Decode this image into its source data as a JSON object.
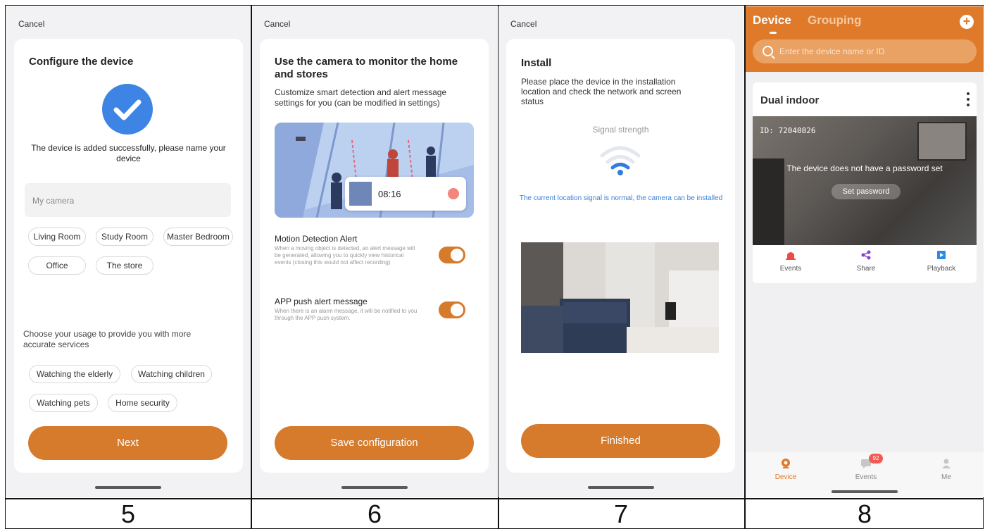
{
  "screen5": {
    "cancel": "Cancel",
    "title": "Configure the device",
    "success_text": "The device is added successfully, please name your device",
    "name_placeholder": "My camera",
    "room_chips": [
      "Living Room",
      "Study Room",
      "Master Bedroom",
      "Office",
      "The store"
    ],
    "usage_prompt": "Choose your usage to provide you with more accurate services",
    "usage_chips": [
      "Watching the elderly",
      "Watching children",
      "Watching pets",
      "Home security"
    ],
    "next_label": "Next"
  },
  "screen6": {
    "cancel": "Cancel",
    "title": "Use the camera to monitor the home and stores",
    "subtitle": "Customize smart detection and alert message settings for you (can be modified in settings)",
    "illustration_time": "08:16",
    "motion_title": "Motion Detection Alert",
    "motion_desc": "When a moving object is detected, an alert message will be generated, allowing you to quickly view historical events (closing this would not affect recording)",
    "push_title": "APP push alert message",
    "push_desc": "When there is an alarm message, it will be notified to you through the APP push system.",
    "save_label": "Save configuration"
  },
  "screen7": {
    "cancel": "Cancel",
    "title": "Install",
    "desc": "Please place the device in the installation location and check the network and screen status",
    "signal_label": "Signal strength",
    "signal_status": "The current location signal is normal, the camera can be installed",
    "finished_label": "Finished"
  },
  "screen8": {
    "tab_device": "Device",
    "tab_grouping": "Grouping",
    "search_placeholder": "Enter the device name or ID",
    "device_name": "Dual indoor",
    "device_id": "ID: 72040826",
    "no_password": "The device does not have a password set",
    "set_password": "Set password",
    "actions": [
      "Events",
      "Share",
      "Playback"
    ],
    "nav": [
      "Device",
      "Events",
      "Me"
    ],
    "events_badge": "92"
  },
  "step_numbers": [
    "5",
    "6",
    "7",
    "8"
  ],
  "colors": {
    "accent": "#d67a2c",
    "blue": "#2f7de0",
    "background": "#f2f2f4"
  }
}
